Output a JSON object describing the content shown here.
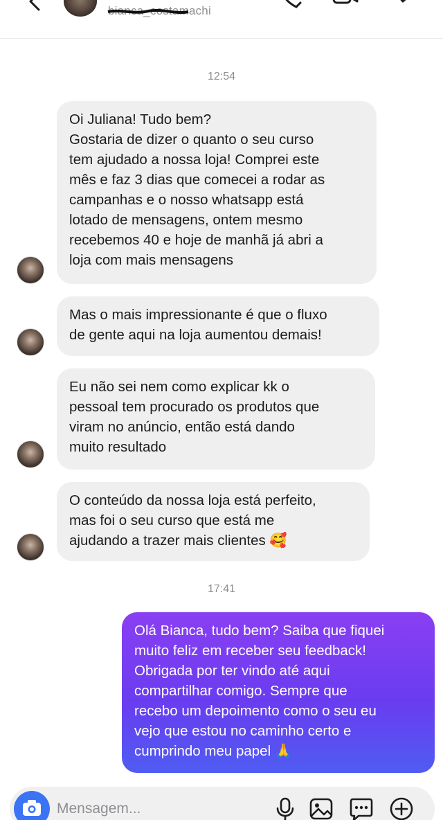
{
  "header": {
    "username": "bianca_costamachi",
    "back_icon": "chevron-left-icon",
    "icons": [
      "phone-icon",
      "video-icon",
      "tag-icon"
    ]
  },
  "timestamps": [
    "12:54",
    "17:41"
  ],
  "incoming_messages": [
    {
      "text": "Oi Juliana! Tudo bem?\nGostaria de dizer o quanto o seu curso\ntem ajudado a nossa loja! Comprei este\nmês e faz 3 dias que comecei a rodar as\ncampanhas e o nosso whatsapp está\nlotado de mensagens, ontem mesmo\nrecebemos 40 e hoje de manhã já abri a\nloja com mais mensagens"
    },
    {
      "text": "Mas o mais impressionante é que o fluxo\nde gente aqui na loja aumentou demais!"
    },
    {
      "text": "Eu não sei nem como explicar kk o\npessoal tem procurado os produtos que\nviram no anúncio, então está dando\nmuito resultado"
    },
    {
      "text": "O conteúdo da nossa loja está perfeito,\nmas foi o seu curso que está me\najudando a trazer mais clientes 🥰"
    }
  ],
  "outgoing_messages": [
    {
      "text": "Olá Bianca, tudo bem? Saiba que fiquei\nmuito feliz em receber seu feedback!\nObrigada por ter vindo até aqui\ncompartilhar comigo. Sempre que\nrecebo um depoimento como o seu eu\nvejo que estou no caminho certo e\ncumprindo meu papel 🙏"
    }
  ],
  "composer": {
    "placeholder": "Mensagem...",
    "icons": [
      "camera-icon",
      "microphone-icon",
      "gallery-icon",
      "sticker-icon",
      "plus-icon"
    ]
  },
  "colors": {
    "incoming_bubble": "#efefef",
    "outgoing_gradient_top": "#8a3ff2",
    "outgoing_gradient_bottom": "#4f5cf2",
    "camera_button": "#3b73f5"
  }
}
